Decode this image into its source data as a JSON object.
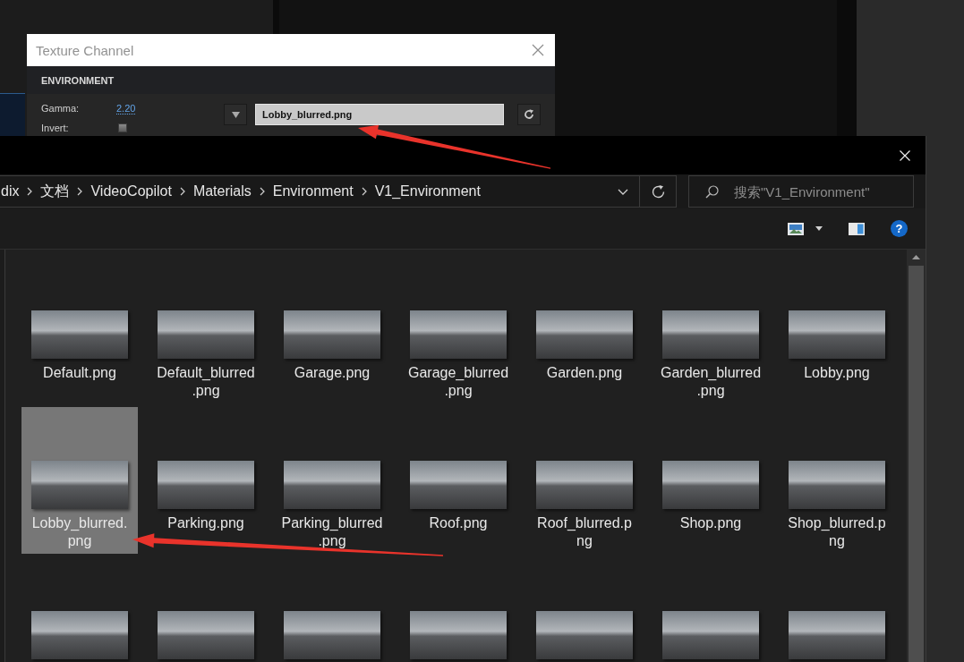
{
  "texture_channel_dialog": {
    "title": "Texture Channel",
    "section": "ENVIRONMENT",
    "settings": [
      {
        "kind": "value",
        "label": "Gamma:",
        "value": "2.20"
      },
      {
        "kind": "checkbox",
        "label": "Invert:",
        "checked": false
      }
    ],
    "file_field": {
      "value": "Lobby_blurred.png"
    }
  },
  "file_explorer": {
    "breadcrumb": [
      "dix",
      "文档",
      "VideoCopilot",
      "Materials",
      "Environment",
      "V1_Environment"
    ],
    "search": {
      "placeholder": "搜索\"V1_Environment\""
    },
    "help_button": "?",
    "files": [
      {
        "label": "Default.png",
        "selected": false
      },
      {
        "label": "Default_blurred.png",
        "selected": false
      },
      {
        "label": "Garage.png",
        "selected": false
      },
      {
        "label": "Garage_blurred.png",
        "selected": false
      },
      {
        "label": "Garden.png",
        "selected": false
      },
      {
        "label": "Garden_blurred.png",
        "selected": false
      },
      {
        "label": "Lobby.png",
        "selected": false
      },
      {
        "label": "Lobby_blurred.png",
        "selected": true
      },
      {
        "label": "Parking.png",
        "selected": false
      },
      {
        "label": "Parking_blurred.png",
        "selected": false
      },
      {
        "label": "Roof.png",
        "selected": false
      },
      {
        "label": "Roof_blurred.png",
        "selected": false
      },
      {
        "label": "Shop.png",
        "selected": false
      },
      {
        "label": "Shop_blurred.png",
        "selected": false
      },
      {
        "selected": false
      },
      {
        "selected": false
      },
      {
        "selected": false
      },
      {
        "selected": false
      },
      {
        "selected": false
      },
      {
        "selected": false
      },
      {
        "selected": false
      }
    ]
  },
  "annotations": [
    {
      "kind": "arrow"
    },
    {
      "kind": "arrow"
    }
  ]
}
